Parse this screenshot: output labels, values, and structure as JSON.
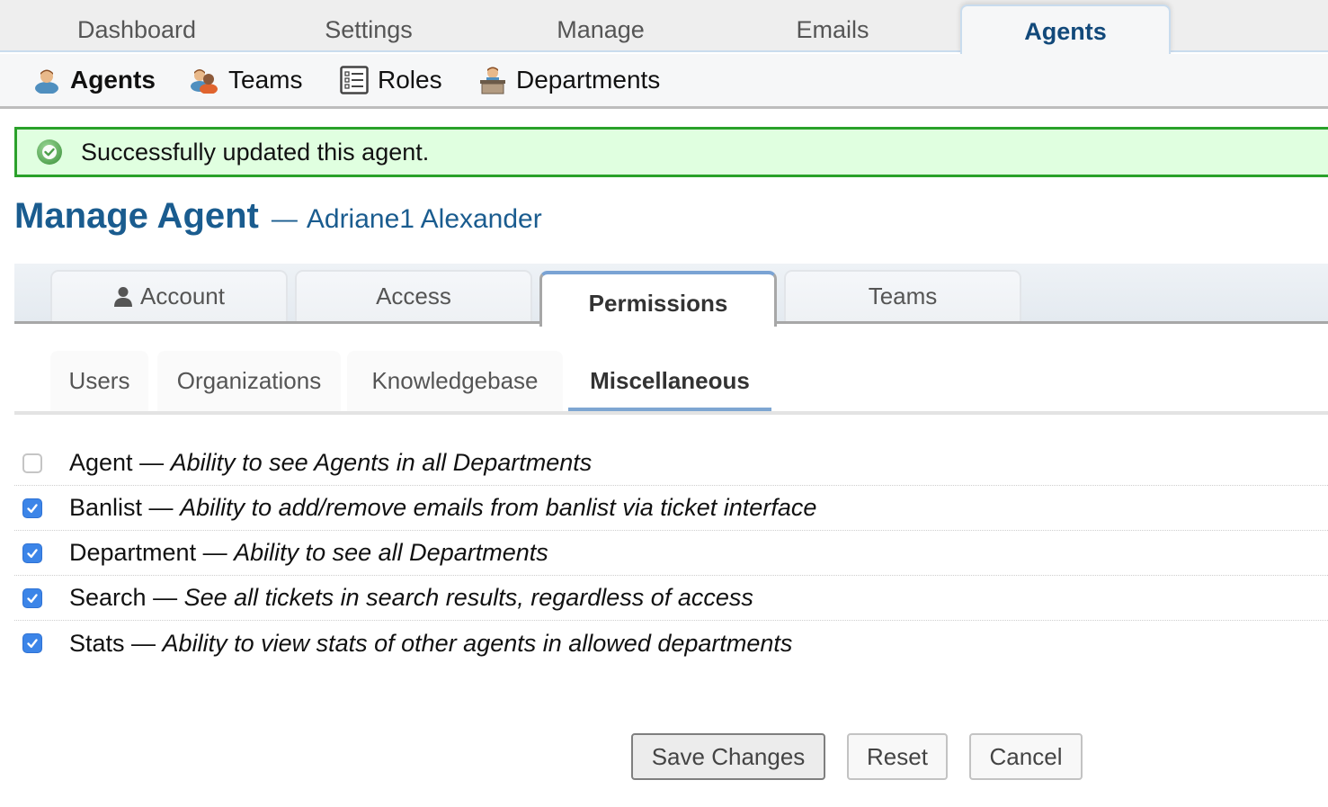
{
  "top_nav": {
    "tabs": [
      {
        "label": "Dashboard",
        "active": false
      },
      {
        "label": "Settings",
        "active": false
      },
      {
        "label": "Manage",
        "active": false
      },
      {
        "label": "Emails",
        "active": false
      },
      {
        "label": "Agents",
        "active": true
      }
    ]
  },
  "sub_nav": {
    "items": [
      {
        "label": "Agents",
        "icon": "agent-icon",
        "active": true
      },
      {
        "label": "Teams",
        "icon": "teams-icon",
        "active": false
      },
      {
        "label": "Roles",
        "icon": "roles-list-icon",
        "active": false
      },
      {
        "label": "Departments",
        "icon": "department-icon",
        "active": false
      }
    ]
  },
  "alert": {
    "type": "success",
    "icon": "check-circle-icon",
    "message": "Successfully updated this agent."
  },
  "heading": {
    "title": "Manage Agent",
    "separator": "—",
    "agent_name": "Adriane1 Alexander"
  },
  "main_tabs": [
    {
      "label": "Account",
      "icon": "user-icon",
      "active": false
    },
    {
      "label": "Access",
      "active": false
    },
    {
      "label": "Permissions",
      "active": true
    },
    {
      "label": "Teams",
      "active": false
    }
  ],
  "sub_tabs": [
    {
      "label": "Users",
      "active": false
    },
    {
      "label": "Organizations",
      "active": false
    },
    {
      "label": "Knowledgebase",
      "active": false
    },
    {
      "label": "Miscellaneous",
      "active": true
    }
  ],
  "permissions": [
    {
      "name": "Agent",
      "separator": "—",
      "description": "Ability to see Agents in all Departments",
      "checked": false
    },
    {
      "name": "Banlist",
      "separator": "—",
      "description": "Ability to add/remove emails from banlist via ticket interface",
      "checked": true
    },
    {
      "name": "Department",
      "separator": "—",
      "description": "Ability to see all Departments",
      "checked": true
    },
    {
      "name": "Search",
      "separator": "—",
      "description": "See all tickets in search results, regardless of access",
      "checked": true
    },
    {
      "name": "Stats",
      "separator": "—",
      "description": "Ability to view stats of other agents in allowed departments",
      "checked": true
    }
  ],
  "actions": {
    "save_label": "Save Changes",
    "reset_label": "Reset",
    "cancel_label": "Cancel"
  },
  "colors": {
    "brand_blue": "#1a5c8f",
    "success_border": "#2aa12a",
    "success_bg": "#e0ffe0",
    "checkbox_checked": "#3c85e8",
    "active_tab_accent": "#7aa3d4"
  }
}
